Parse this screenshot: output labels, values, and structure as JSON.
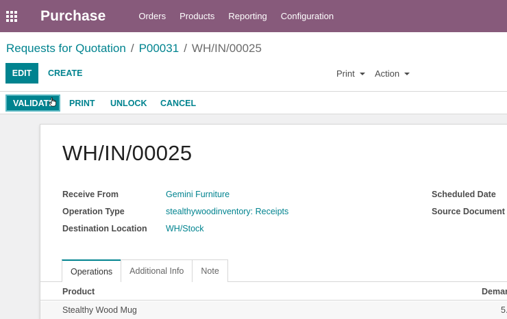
{
  "navbar": {
    "app_title": "Purchase",
    "menu": [
      "Orders",
      "Products",
      "Reporting",
      "Configuration"
    ]
  },
  "breadcrumb": {
    "items": [
      "Requests for Quotation",
      "P00031"
    ],
    "separator": "/",
    "current": "WH/IN/00025"
  },
  "control_panel": {
    "edit_label": "EDIT",
    "create_label": "CREATE",
    "print_label": "Print",
    "action_label": "Action"
  },
  "statusbar": {
    "validate_label": "VALIDATE",
    "print_label": "PRINT",
    "unlock_label": "UNLOCK",
    "cancel_label": "CANCEL"
  },
  "form": {
    "name": "WH/IN/00025",
    "fields": {
      "receive_from": {
        "label": "Receive From",
        "value": "Gemini Furniture"
      },
      "operation_type": {
        "label": "Operation Type",
        "value": "stealthywoodinventory: Receipts"
      },
      "destination_location": {
        "label": "Destination Location",
        "value": "WH/Stock"
      },
      "scheduled_date": {
        "label": "Scheduled Date"
      },
      "source_document": {
        "label": "Source Document"
      }
    },
    "tabs": [
      "Operations",
      "Additional Info",
      "Note"
    ],
    "table": {
      "headers": {
        "product": "Product",
        "demand": "Demar"
      },
      "rows": [
        {
          "product": "Stealthy Wood Mug",
          "demand": "5."
        }
      ]
    }
  },
  "colors": {
    "brand": "#875a7b",
    "accent": "#00838f"
  }
}
